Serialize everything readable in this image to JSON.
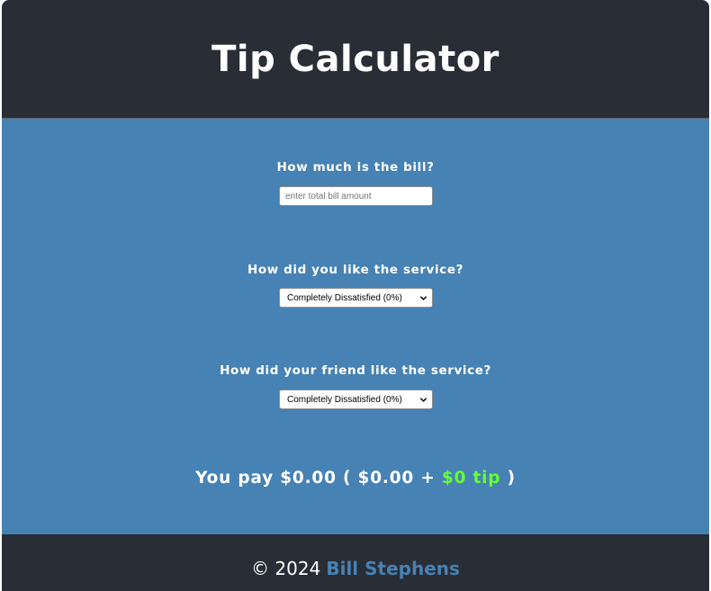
{
  "header": {
    "title": "Tip Calculator"
  },
  "form": {
    "bill_question": "How much is the bill?",
    "bill_placeholder": "enter total bill amount",
    "bill_value": "",
    "service_question": "How did you like the service?",
    "service_selected": "Completely Dissatisfied (0%)",
    "friend_question": "How did your friend like the service?",
    "friend_selected": "Completely Dissatisfied (0%)"
  },
  "result": {
    "prefix": "You pay",
    "total": "$0.00",
    "open": "(",
    "bill": "$0.00",
    "plus": "+",
    "tip": "$0 tip",
    "close": ")"
  },
  "footer": {
    "copyright": "© 2024",
    "author": "Bill Stephens"
  },
  "colors": {
    "header_bg": "#292d36",
    "main_bg": "#4682b4",
    "tip_accent": "#66ff33",
    "author_link": "#4682b4"
  },
  "icons": {
    "select_arrow": "chevron-down-icon"
  }
}
